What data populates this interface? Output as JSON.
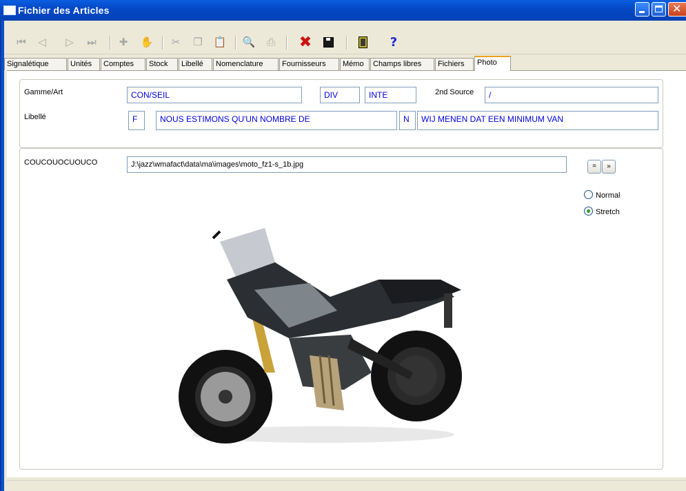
{
  "window": {
    "title": "Fichier des Articles"
  },
  "toolbar": {
    "buttons": [
      "first-icon",
      "prev-icon",
      "next-icon",
      "last-icon",
      "add-icon",
      "hand-icon",
      "cut-icon",
      "copy-icon",
      "paste-icon",
      "search-icon",
      "print-icon",
      "delete-icon",
      "save-icon",
      "exit-icon",
      "help-icon"
    ]
  },
  "tabs": [
    "Signalétique",
    "Unités",
    "Comptes",
    "Stock",
    "Libellé",
    "Nomenclature",
    "Fournisseurs",
    "Mémo",
    "Champs libres",
    "Fichiers",
    "Photo"
  ],
  "active_tab": "Photo",
  "form": {
    "gamme_label": "Gamme/Art",
    "gamme_value": "CON/SEIL",
    "div_value": "DIV",
    "inte_value": "INTE",
    "second_source_label": "2nd Source",
    "second_source_value": "/",
    "libelle_label": "Libellé",
    "lang1_code": "F",
    "lang1_text": "NOUS ESTIMONS QU'UN NOMBRE DE",
    "lang2_code": "N",
    "lang2_text": "WIJ MENEN DAT EEN MINIMUM VAN"
  },
  "photo": {
    "label": "COUCOUOCUOUCO",
    "path": "J:\\jazz\\wmafact\\data\\ma\\images\\moto_fz1-s_1b.jpg",
    "btn_equal": "=",
    "btn_next": "»",
    "mode_options": [
      "Normal",
      "Stretch"
    ],
    "selected_mode": "Stretch"
  },
  "colors": {
    "title_bar": "#0548c8",
    "field_text": "#0000d8",
    "active_tab_accent": "#f0a020"
  }
}
